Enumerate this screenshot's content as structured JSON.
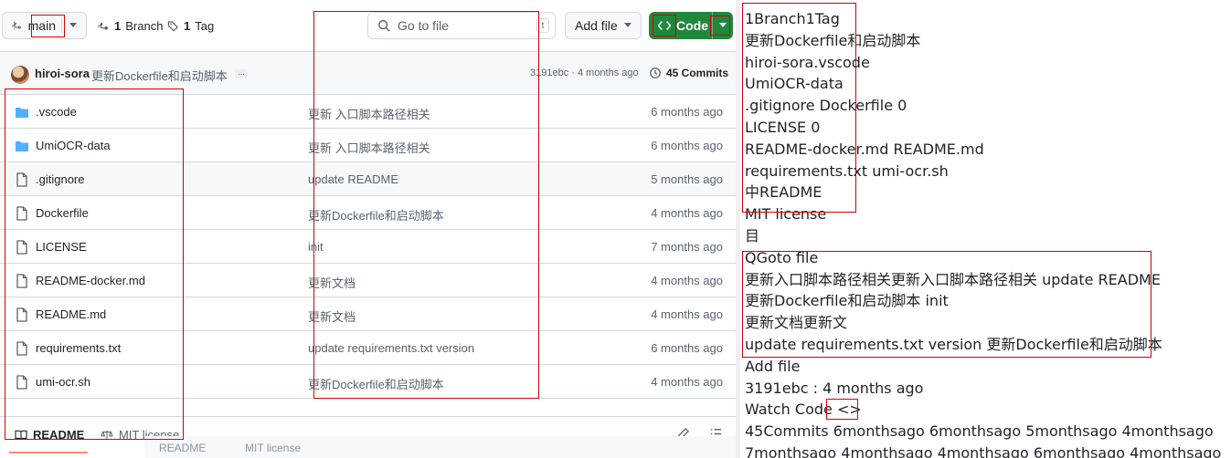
{
  "github": {
    "branch_button": {
      "label": "main"
    },
    "branches": {
      "count": "1",
      "label": "Branch"
    },
    "tags": {
      "count": "1",
      "label": "Tag"
    },
    "search": {
      "placeholder": "Go to file",
      "shortcut": "t"
    },
    "add_file_button": {
      "label": "Add file"
    },
    "code_button": {
      "label": "Code"
    },
    "last_commit": {
      "author": "hiroi-sora",
      "message": "更新Dockerfile和启动脚本",
      "hash_and_time": "3191ebc · 4 months ago",
      "commits_label": "45 Commits"
    },
    "files": [
      {
        "name": ".vscode",
        "type": "folder",
        "message": "更新 入口脚本路径相关",
        "age": "6 months ago"
      },
      {
        "name": "UmiOCR-data",
        "type": "folder",
        "message": "更新 入口脚本路径相关",
        "age": "6 months ago"
      },
      {
        "name": ".gitignore",
        "type": "file",
        "message": "update README",
        "age": "5 months ago"
      },
      {
        "name": "Dockerfile",
        "type": "file",
        "message": "更新Dockerfile和启动脚本",
        "age": "4 months ago"
      },
      {
        "name": "LICENSE",
        "type": "file",
        "message": "init",
        "age": "7 months ago"
      },
      {
        "name": "README-docker.md",
        "type": "file",
        "message": "更新文档",
        "age": "4 months ago"
      },
      {
        "name": "README.md",
        "type": "file",
        "message": "更新文档",
        "age": "4 months ago"
      },
      {
        "name": "requirements.txt",
        "type": "file",
        "message": "update requirements.txt version",
        "age": "6 months ago"
      },
      {
        "name": "umi-ocr.sh",
        "type": "file",
        "message": "更新Dockerfile和启动脚本",
        "age": "4 months ago"
      }
    ],
    "readme_tab": "README",
    "license_tab": "MIT license",
    "bottom_strip": {
      "readme": "README",
      "license": "MIT license"
    }
  },
  "ocr_panel": {
    "lines": [
      "1Branch1Tag",
      "更新Dockerfile和启动脚本",
      "hiroi-sora.vscode",
      "UmiOCR-data",
      ".gitignore Dockerfile 0",
      "LICENSE 0",
      "README-docker.md README.md",
      "requirements.txt umi-ocr.sh",
      "中README",
      "MIT license",
      "目",
      "QGoto file",
      "更新入口脚本路径相关更新入口脚本路径相关 update README",
      "更新Dockerfile和启动脚本 init",
      "更新文档更新文",
      "update requirements.txt version 更新Dockerfile和启动脚本",
      "Add file",
      "3191ebc : 4 months ago",
      "Watch Code <>",
      "45Commits 6monthsago 6monthsago 5monthsago 4monthsago",
      "7monthsago 4monthsago 4monthsago 6monthsago 4monthsago"
    ]
  },
  "colors": {
    "accent_green": "#1f883d",
    "highlight_red": "#d40000",
    "text_primary": "#1f2328",
    "text_muted": "#59636e",
    "folder_blue": "#54aeff",
    "border": "#d1d9e0"
  }
}
